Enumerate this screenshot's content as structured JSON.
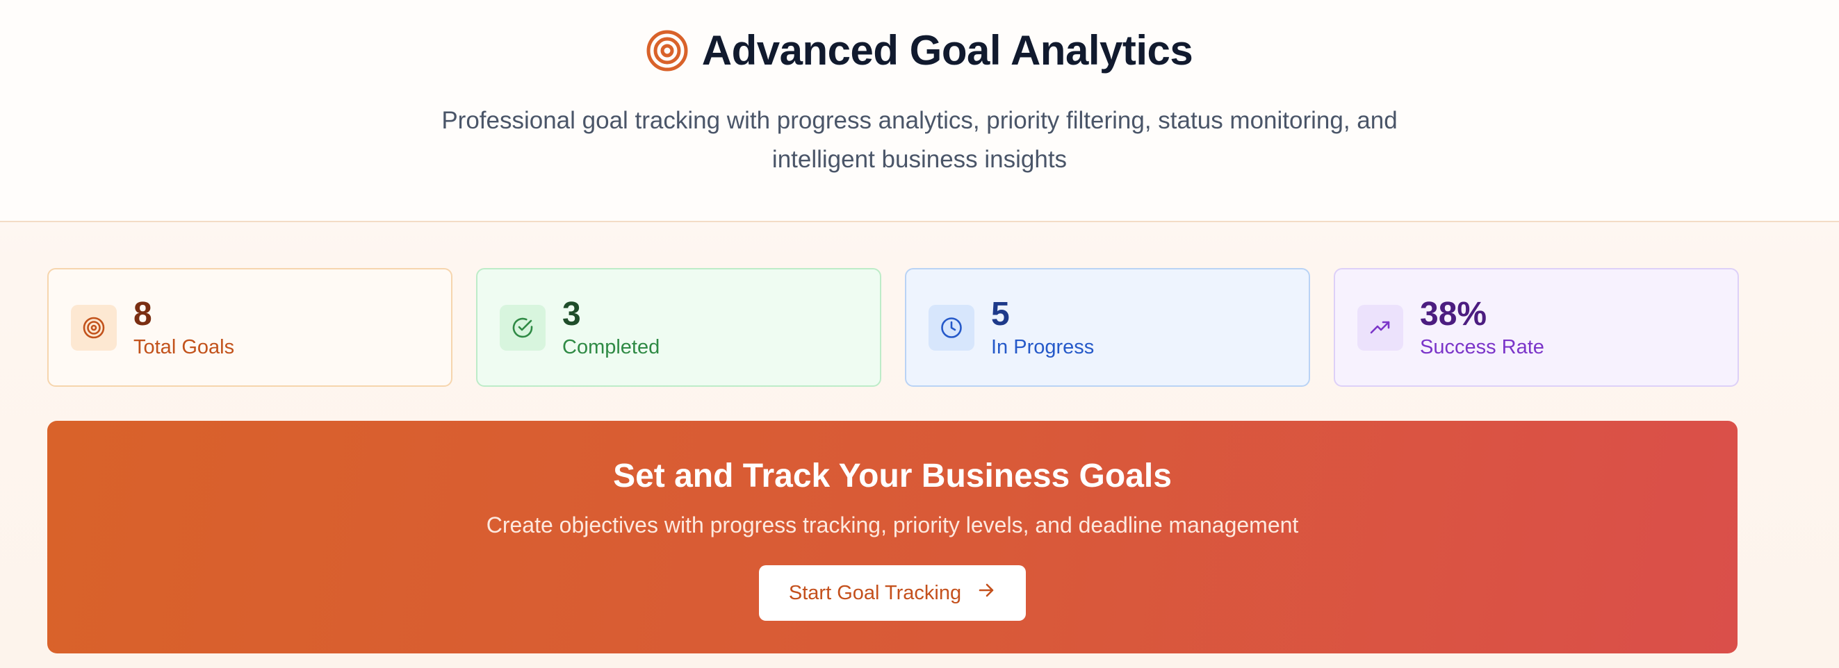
{
  "header": {
    "icon": "target-icon",
    "title": "Advanced Goal Analytics",
    "subtitle": "Professional goal tracking with progress analytics, priority filtering, status monitoring, and intelligent business insights"
  },
  "stats": [
    {
      "value": "8",
      "label": "Total Goals",
      "icon": "target-icon"
    },
    {
      "value": "3",
      "label": "Completed",
      "icon": "check-circle-icon"
    },
    {
      "value": "5",
      "label": "In Progress",
      "icon": "clock-icon"
    },
    {
      "value": "38%",
      "label": "Success Rate",
      "icon": "trending-up-icon"
    }
  ],
  "banner": {
    "title": "Set and Track Your Business Goals",
    "description": "Create objectives with progress tracking, priority levels, and deadline management",
    "button_label": "Start Goal Tracking",
    "button_icon": "arrow-right-icon"
  },
  "colors": {
    "accent": "#d9622a",
    "title": "#111a2e",
    "banner_end": "#da4f4a"
  }
}
